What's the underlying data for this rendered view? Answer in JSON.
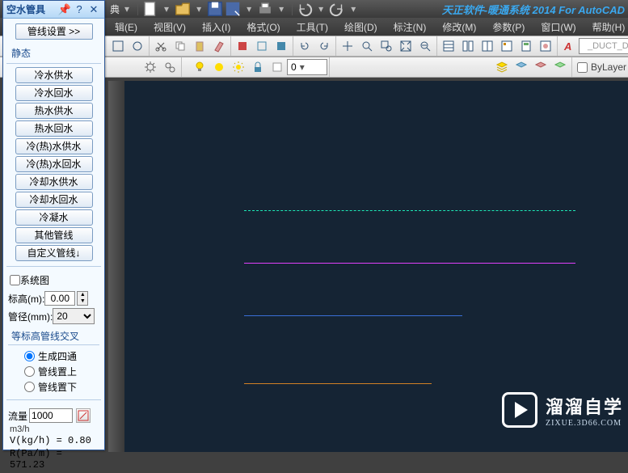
{
  "topbar": {
    "dict_label": "典",
    "title": "天正软件-暖通系统 2014 For AutoCAD"
  },
  "menus": [
    "辑(E)",
    "视图(V)",
    "插入(I)",
    "格式(O)",
    "工具(T)",
    "绘图(D)",
    "标注(N)",
    "修改(M)",
    "参数(P)",
    "窗口(W)",
    "帮助(H)"
  ],
  "toolbar2_input": "0",
  "toolbar2_right": {
    "duct_dim": "_DUCT_DIM"
  },
  "toolbar3": {
    "bylayer": "ByLayer"
  },
  "panel": {
    "title": "空水管具",
    "main_btn": "管线设置 >>",
    "section_static": "静态",
    "pipes": [
      "冷水供水",
      "冷水回水",
      "热水供水",
      "热水回水",
      "冷(热)水供水",
      "冷(热)水回水",
      "冷却水供水",
      "冷却水回水",
      "冷凝水",
      "其他管线",
      "自定义管线↓"
    ],
    "system_check": "系统图",
    "elev_label": "标高(m):",
    "elev_value": "0.00",
    "diam_label": "管径(mm):",
    "diam_value": "20",
    "cross_title": "等标高管线交叉",
    "radios": [
      "生成四通",
      "管线置上",
      "管线置下"
    ],
    "flow_label": "流量",
    "flow_unit": "m3/h",
    "flow_value": "1000",
    "calc1": "V(kg/h) = 0.80",
    "calc2": "R(Pa/m) = 571.23"
  },
  "watermark": {
    "main": "溜溜自学",
    "sub": "ZIXUE.3D66.COM"
  }
}
